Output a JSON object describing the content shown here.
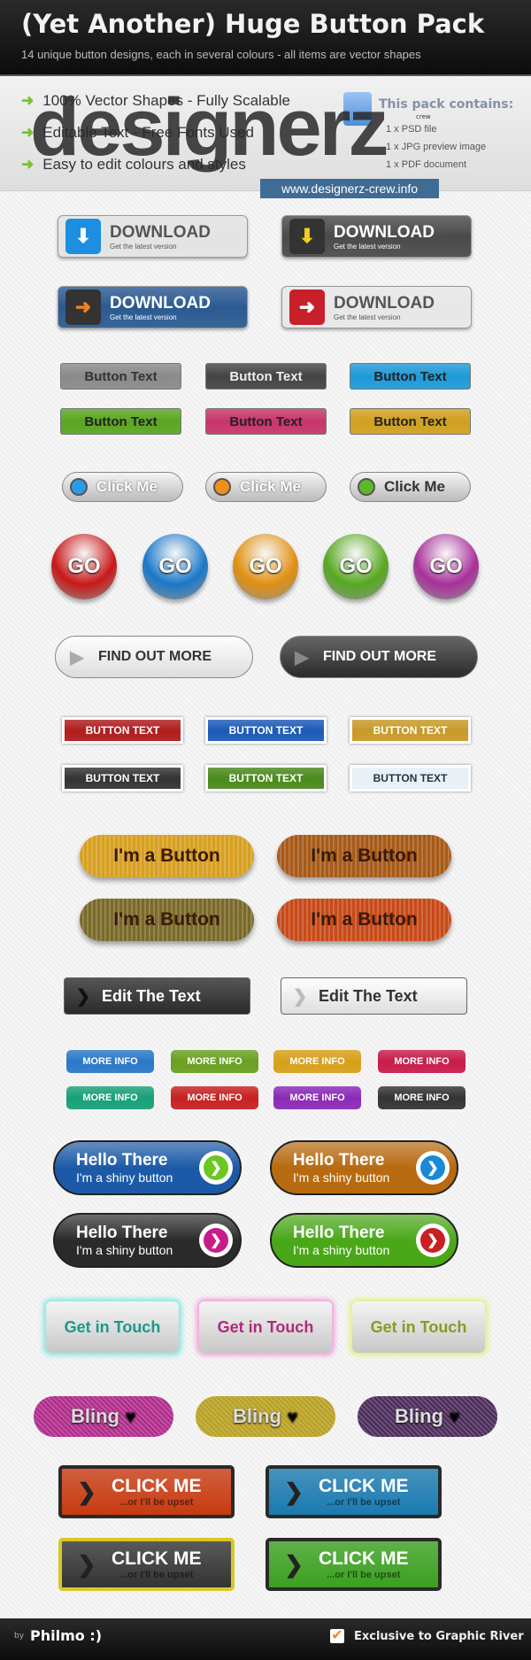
{
  "header": {
    "title": "(Yet Another) Huge Button Pack",
    "subtitle": "14 unique button designs, each in several colours - all items are vector shapes"
  },
  "features": [
    "100% Vector Shapes - Fully Scalable",
    "Editable Text - Free Fonts Used",
    "Easy to edit colours and styles"
  ],
  "pack": {
    "title": "This pack contains:",
    "items": [
      "1 x PSD file",
      "1 x JPG preview image",
      "1 x PDF document"
    ]
  },
  "watermark": {
    "logo": "designerz",
    "tag": "crew",
    "url": "www.designerz-crew.info"
  },
  "buttons": {
    "download": {
      "label": "DOWNLOAD",
      "sub": "Get the latest version",
      "colors": [
        "#e4e4e4",
        "#4a4a4a",
        "#2b5a92",
        "#e8e8e8"
      ],
      "icon_colors": [
        "#1c8fe0",
        "#333",
        "#333",
        "#c8202a"
      ]
    },
    "button_text": {
      "label": "Button Text",
      "colors": [
        "#8a8a8a",
        "#444444",
        "#1e9ad8",
        "#5aa620",
        "#c8356a",
        "#d0a020"
      ]
    },
    "click_me": {
      "label": "Click Me",
      "dot_colors": [
        "#2a9be8",
        "#f0901a",
        "#5ab82a"
      ]
    },
    "go": {
      "label": "GO",
      "colors": [
        "#c81818",
        "#1a78c8",
        "#e09010",
        "#56a820",
        "#a8309a"
      ]
    },
    "find_out_more": {
      "label": "FIND OUT MORE",
      "colors": [
        "#f0f0f0",
        "#3a3a3a"
      ]
    },
    "button_text_caps": {
      "label": "BUTTON TEXT",
      "colors": [
        "#b01c1c",
        "#1c5ab8",
        "#c89a28",
        "#333333",
        "#4a8a1c",
        "#e8f0f8"
      ]
    },
    "im_a_button": {
      "label": "I'm a Button",
      "colors": [
        "#d8a020",
        "#a85a18",
        "#7a6a2a",
        "#c84a18"
      ]
    },
    "edit_text": {
      "label": "Edit The Text",
      "colors": [
        "#3a3a3a",
        "#e8e8e8"
      ]
    },
    "more_info": {
      "label": "MORE INFO",
      "colors": [
        "#2a78c8",
        "#6aa020",
        "#d8a018",
        "#c81c4a",
        "#18a078",
        "#c82020",
        "#8a2ab8",
        "#333333"
      ]
    },
    "hello_there": {
      "label": "Hello There",
      "sub": "I'm a shiny button",
      "colors": [
        "#1c5aa8",
        "#b86a10",
        "#2a2a2a",
        "#4aa818"
      ],
      "arrow_colors": [
        "#6ac820",
        "#1a8ad8",
        "#c81c8a",
        "#c82020"
      ]
    },
    "get_in_touch": {
      "label": "Get in Touch",
      "colors": [
        "#1a9a8a",
        "#b02a7a",
        "#8a9a20"
      ],
      "glow": [
        "#7fe8e0",
        "#f0a0d8",
        "#e0f080"
      ]
    },
    "bling": {
      "label": "Bling",
      "colors": [
        "#b02a8a",
        "#b8a020",
        "#4a2a5a"
      ]
    },
    "click_me_big": {
      "label": "CLICK ME",
      "sub": "...or I'll be upset",
      "colors": [
        "#c83a10",
        "#1a7ab0",
        "#333333",
        "#3aa020"
      ],
      "frame": [
        "#2a2a2a",
        "#2a2a2a",
        "#d8c820",
        "#2a2a2a"
      ]
    }
  },
  "footer": {
    "by": "by",
    "author": "Philmo :)",
    "exclusive": "Exclusive to Graphic River"
  }
}
